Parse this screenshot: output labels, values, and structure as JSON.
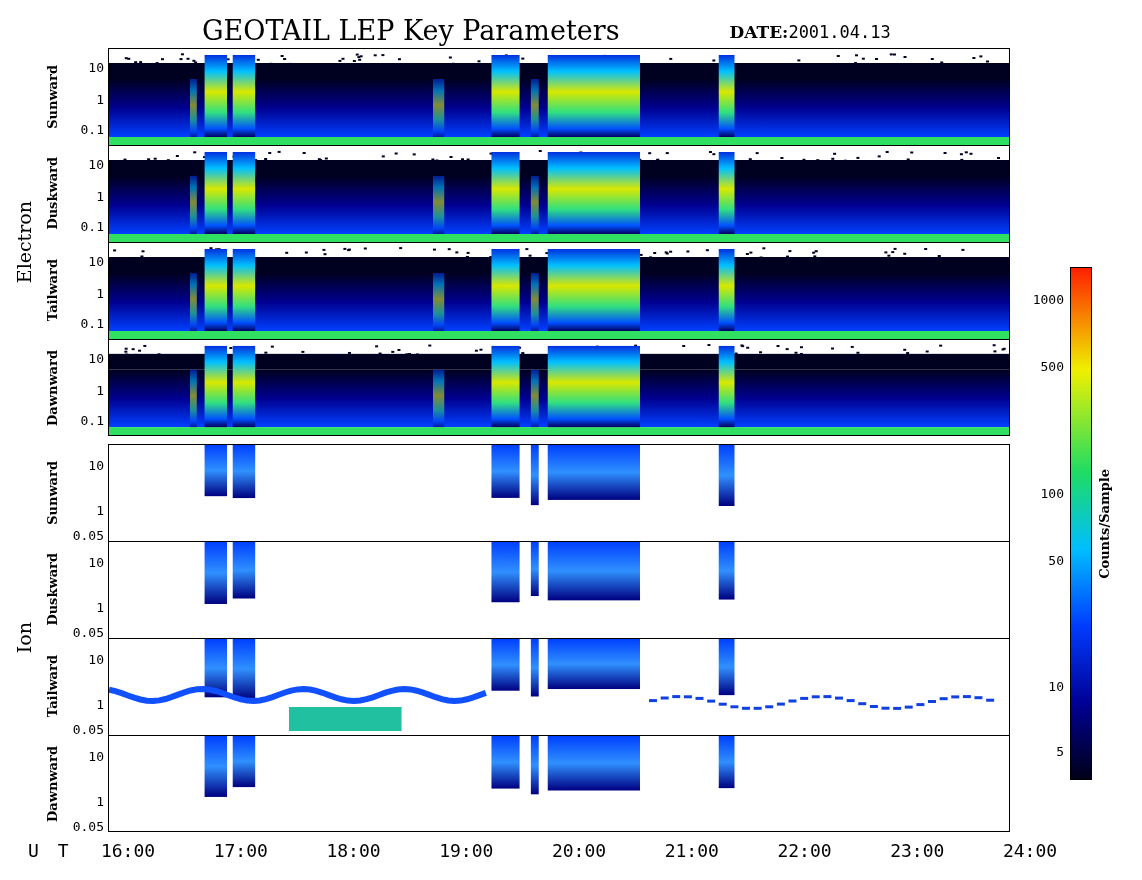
{
  "title": "GEOTAIL LEP Key Parameters",
  "date_label": "DATE:",
  "date": "2001.04.13",
  "groups": [
    {
      "label": "Electron",
      "kind": "electron",
      "panels": [
        {
          "label": "Sunward",
          "kind": "dense",
          "y_ticks": [
            "10",
            "1",
            "0.1"
          ]
        },
        {
          "label": "Duskward",
          "kind": "dense",
          "y_ticks": [
            "10",
            "1",
            "0.1"
          ]
        },
        {
          "label": "Tailward",
          "kind": "dense",
          "y_ticks": [
            "10",
            "1",
            "0.1"
          ]
        },
        {
          "label": "Dawnward",
          "kind": "dense",
          "y_ticks": [
            "10",
            "1",
            "0.1"
          ]
        }
      ]
    },
    {
      "label": "Ion",
      "kind": "ion",
      "panels": [
        {
          "label": "Sunward",
          "kind": "sparse",
          "y_ticks": [
            "10",
            "1",
            "0.05"
          ]
        },
        {
          "label": "Duskward",
          "kind": "sparse",
          "y_ticks": [
            "10",
            "1",
            "0.05"
          ]
        },
        {
          "label": "Tailward",
          "kind": "band",
          "y_ticks": [
            "10",
            "1",
            "0.05"
          ]
        },
        {
          "label": "Dawnward",
          "kind": "sparse",
          "y_ticks": [
            "10",
            "1",
            "0.05"
          ]
        }
      ]
    }
  ],
  "x_axis": {
    "label": "U T",
    "ticks": [
      "16:00",
      "17:00",
      "18:00",
      "19:00",
      "20:00",
      "21:00",
      "22:00",
      "23:00",
      "24:00"
    ]
  },
  "colorbar": {
    "label": "Counts/Sample",
    "ticks": [
      "1000",
      "500",
      "100",
      "50",
      "10",
      "5"
    ]
  }
}
